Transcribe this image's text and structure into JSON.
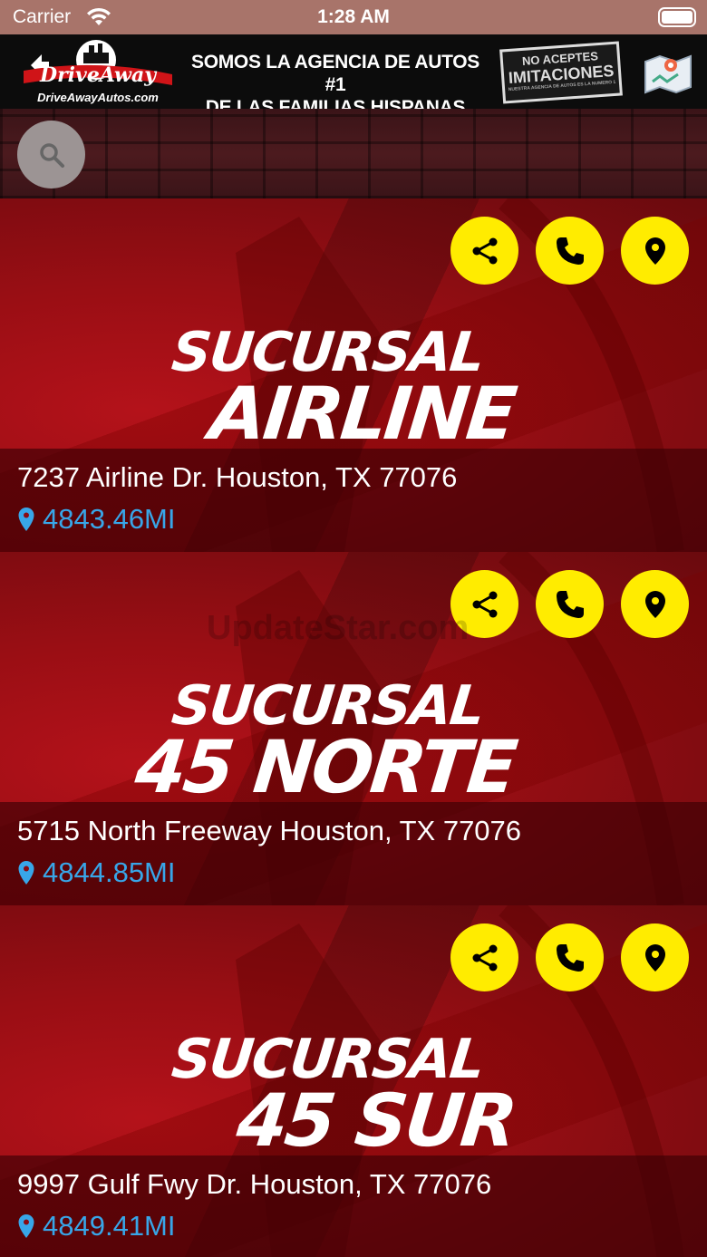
{
  "status_bar": {
    "carrier": "Carrier",
    "time": "1:28 AM"
  },
  "banner": {
    "logo_text": "DriveAway",
    "logo_url": "DriveAwayAutos.com",
    "slogan_line1": "SOMOS LA AGENCIA DE AUTOS #1",
    "slogan_line2": "DE LAS FAMILIAS HISPANAS",
    "stamp_top": "NO ACEPTES",
    "stamp_main": "IMITACIONES",
    "stamp_sub": "NUESTRA AGENCIA DE AUTOS ES LA NUMERO 1"
  },
  "search": {
    "icon": "search-icon"
  },
  "branches": [
    {
      "title_line1": "SUCURSAL",
      "title_line2": "AIRLINE",
      "address": "7237 Airline Dr. Houston, TX 77076",
      "distance": "4843.46MI"
    },
    {
      "title_line1": "SUCURSAL",
      "title_line2": "45 NORTE",
      "address": "5715 North Freeway Houston, TX 77076",
      "distance": "4844.85MI"
    },
    {
      "title_line1": "SUCURSAL",
      "title_line2": "45 SUR",
      "address": "9997 Gulf Fwy Dr. Houston, TX 77076",
      "distance": "4849.41MI"
    }
  ],
  "watermark": "UpdateStar.com",
  "colors": {
    "status_bar": "#a8746a",
    "action_button": "#ffec00",
    "distance_text": "#38a6e8",
    "card_red": "#b4121a"
  }
}
